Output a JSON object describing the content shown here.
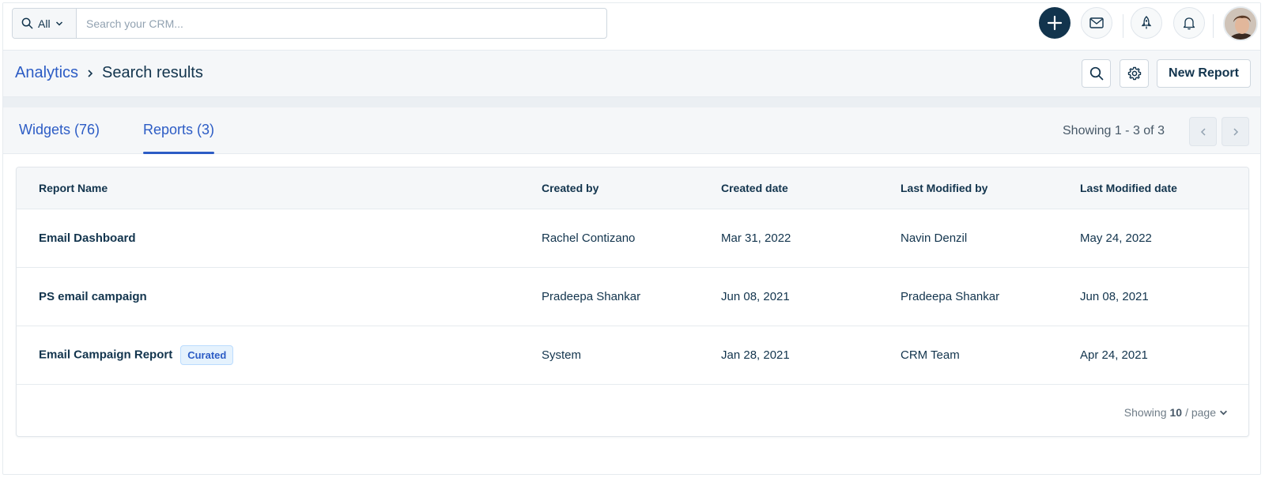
{
  "topbar": {
    "scope_label": "All",
    "search_placeholder": "Search your CRM..."
  },
  "header": {
    "breadcrumb_parent": "Analytics",
    "breadcrumb_current": "Search results",
    "new_report_label": "New Report"
  },
  "tabs": [
    {
      "label": "Widgets (76)",
      "active": false
    },
    {
      "label": "Reports (3)",
      "active": true
    }
  ],
  "pagination": {
    "range_text": "Showing 1 - 3 of 3",
    "per_page_prefix": "Showing",
    "per_page_value": "10",
    "per_page_suffix": "/ page"
  },
  "table": {
    "columns": [
      "Report Name",
      "Created by",
      "Created date",
      "Last Modified by",
      "Last Modified date"
    ],
    "rows": [
      {
        "name": "Email Dashboard",
        "badge": "",
        "created_by": "Rachel Contizano",
        "created_date": "Mar 31, 2022",
        "modified_by": "Navin Denzil",
        "modified_date": "May 24, 2022"
      },
      {
        "name": "PS email campaign",
        "badge": "",
        "created_by": "Pradeepa Shankar",
        "created_date": "Jun 08, 2021",
        "modified_by": "Pradeepa Shankar",
        "modified_date": "Jun 08, 2021"
      },
      {
        "name": "Email Campaign Report",
        "badge": "Curated",
        "created_by": "System",
        "created_date": "Jan 28, 2021",
        "modified_by": "CRM Team",
        "modified_date": "Apr 24, 2021"
      }
    ]
  },
  "colors": {
    "accent": "#2c5cc5",
    "dark_navy": "#12344d",
    "header_bg": "#f5f7f9",
    "badge_bg": "#e5f2fd"
  },
  "icons": [
    "search-icon",
    "chevron-down-icon",
    "plus-icon",
    "mail-icon",
    "rocket-icon",
    "bell-icon",
    "gear-icon",
    "chevron-right-icon",
    "chevron-left-icon"
  ]
}
